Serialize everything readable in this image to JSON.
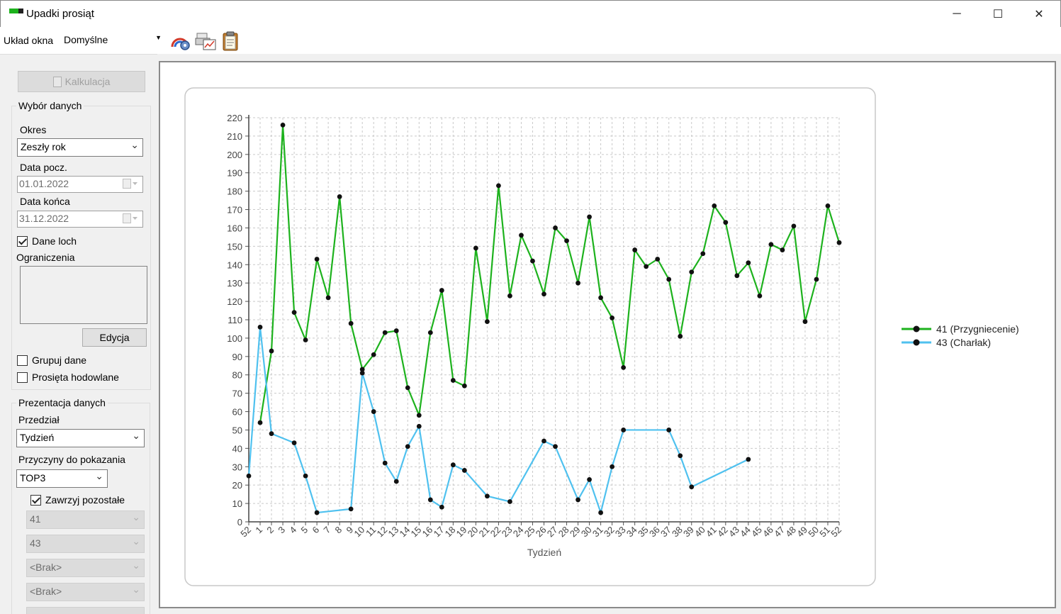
{
  "window": {
    "title": "Upadki prosiąt",
    "minimize": "─",
    "maximize": "☐",
    "close": "✕"
  },
  "toolbar": {
    "layout_label": "Układ okna",
    "layout_value": "Domyślne",
    "icons": [
      "chart-settings-icon",
      "print-chart-icon",
      "clipboard-icon"
    ]
  },
  "left_panel": {
    "calc_button": "Kalkulacja",
    "data_group": {
      "legend": "Wybór danych",
      "period_label": "Okres",
      "period_value": "Zeszły rok",
      "start_label": "Data pocz.",
      "start_value": "01.01.2022",
      "end_label": "Data końca",
      "end_value": "31.12.2022",
      "sows_label": "Dane loch",
      "sows_checked": true,
      "limits_label": "Ograniczenia",
      "edit_button": "Edycja",
      "group_label": "Grupuj dane",
      "group_checked": false,
      "breeding_label": "Prosięta hodowlane",
      "breeding_checked": false
    },
    "presentation_group": {
      "legend": "Prezentacja danych",
      "interval_label": "Przedział",
      "interval_value": "Tydzień",
      "causes_label": "Przyczyny do pokazania",
      "causes_value": "TOP3",
      "include_label": "Zawrzyj pozostałe",
      "include_checked": true,
      "cause_selects": [
        "41",
        "43",
        "<Brak>",
        "<Brak>"
      ]
    }
  },
  "chart_data": {
    "type": "line",
    "xlabel": "Tydzień",
    "ylabel": "",
    "ylim": [
      0,
      220
    ],
    "ytick_step": 10,
    "grid": true,
    "legend_position": "right",
    "categories": [
      "52",
      "1",
      "2",
      "3",
      "4",
      "5",
      "6",
      "7",
      "8",
      "9",
      "10",
      "11",
      "12",
      "13",
      "14",
      "15",
      "16",
      "17",
      "18",
      "19",
      "20",
      "21",
      "22",
      "23",
      "24",
      "25",
      "26",
      "27",
      "28",
      "29",
      "30",
      "31",
      "32",
      "33",
      "34",
      "35",
      "36",
      "37",
      "38",
      "39",
      "40",
      "41",
      "42",
      "43",
      "44",
      "45",
      "46",
      "47",
      "48",
      "49",
      "50",
      "51",
      "52"
    ],
    "series": [
      {
        "name": "41 (Przygniecenie)",
        "color": "#1db21d",
        "points": [
          {
            "x": "1",
            "y": 54
          },
          {
            "x": "2",
            "y": 93
          },
          {
            "x": "3",
            "y": 216
          },
          {
            "x": "4",
            "y": 114
          },
          {
            "x": "5",
            "y": 99
          },
          {
            "x": "6",
            "y": 143
          },
          {
            "x": "7",
            "y": 122
          },
          {
            "x": "8",
            "y": 177
          },
          {
            "x": "9",
            "y": 108
          },
          {
            "x": "10",
            "y": 83
          },
          {
            "x": "11",
            "y": 91
          },
          {
            "x": "12",
            "y": 103
          },
          {
            "x": "13",
            "y": 104
          },
          {
            "x": "14",
            "y": 73
          },
          {
            "x": "15",
            "y": 58
          },
          {
            "x": "16",
            "y": 103
          },
          {
            "x": "17",
            "y": 126
          },
          {
            "x": "18",
            "y": 77
          },
          {
            "x": "19",
            "y": 74
          },
          {
            "x": "20",
            "y": 149
          },
          {
            "x": "21",
            "y": 109
          },
          {
            "x": "22",
            "y": 183
          },
          {
            "x": "23",
            "y": 123
          },
          {
            "x": "24",
            "y": 156
          },
          {
            "x": "25",
            "y": 142
          },
          {
            "x": "26",
            "y": 124
          },
          {
            "x": "27",
            "y": 160
          },
          {
            "x": "28",
            "y": 153
          },
          {
            "x": "29",
            "y": 130
          },
          {
            "x": "30",
            "y": 166
          },
          {
            "x": "31",
            "y": 122
          },
          {
            "x": "32",
            "y": 111
          },
          {
            "x": "33",
            "y": 84
          },
          {
            "x": "34",
            "y": 148
          },
          {
            "x": "35",
            "y": 139
          },
          {
            "x": "36",
            "y": 143
          },
          {
            "x": "37",
            "y": 132
          },
          {
            "x": "38",
            "y": 101
          },
          {
            "x": "39",
            "y": 136
          },
          {
            "x": "40",
            "y": 146
          },
          {
            "x": "41",
            "y": 172
          },
          {
            "x": "42",
            "y": 163
          },
          {
            "x": "43",
            "y": 134
          },
          {
            "x": "44",
            "y": 141
          },
          {
            "x": "45",
            "y": 123
          },
          {
            "x": "46",
            "y": 151
          },
          {
            "x": "47",
            "y": 148
          },
          {
            "x": "48",
            "y": 161
          },
          {
            "x": "49",
            "y": 109
          },
          {
            "x": "50",
            "y": 132
          },
          {
            "x": "51",
            "y": 172
          },
          {
            "x": "52",
            "y": 152
          }
        ]
      },
      {
        "name": "43 (Charłak)",
        "color": "#4fc1ef",
        "points": [
          {
            "x": "52",
            "y": 25
          },
          {
            "x": "1",
            "y": 106
          },
          {
            "x": "2",
            "y": 48
          },
          {
            "x": "4",
            "y": 43
          },
          {
            "x": "5",
            "y": 25
          },
          {
            "x": "6",
            "y": 5
          },
          {
            "x": "9",
            "y": 7
          },
          {
            "x": "10",
            "y": 81
          },
          {
            "x": "11",
            "y": 60
          },
          {
            "x": "12",
            "y": 32
          },
          {
            "x": "13",
            "y": 22
          },
          {
            "x": "14",
            "y": 41
          },
          {
            "x": "15",
            "y": 52
          },
          {
            "x": "16",
            "y": 12
          },
          {
            "x": "17",
            "y": 8
          },
          {
            "x": "18",
            "y": 31
          },
          {
            "x": "19",
            "y": 28
          },
          {
            "x": "21",
            "y": 14
          },
          {
            "x": "23",
            "y": 11
          },
          {
            "x": "26",
            "y": 44
          },
          {
            "x": "27",
            "y": 41
          },
          {
            "x": "29",
            "y": 12
          },
          {
            "x": "30",
            "y": 23
          },
          {
            "x": "31",
            "y": 5
          },
          {
            "x": "32",
            "y": 30
          },
          {
            "x": "33",
            "y": 50
          },
          {
            "x": "37",
            "y": 50
          },
          {
            "x": "38",
            "y": 36
          },
          {
            "x": "39",
            "y": 19
          },
          {
            "x": "44",
            "y": 34
          }
        ]
      }
    ]
  }
}
